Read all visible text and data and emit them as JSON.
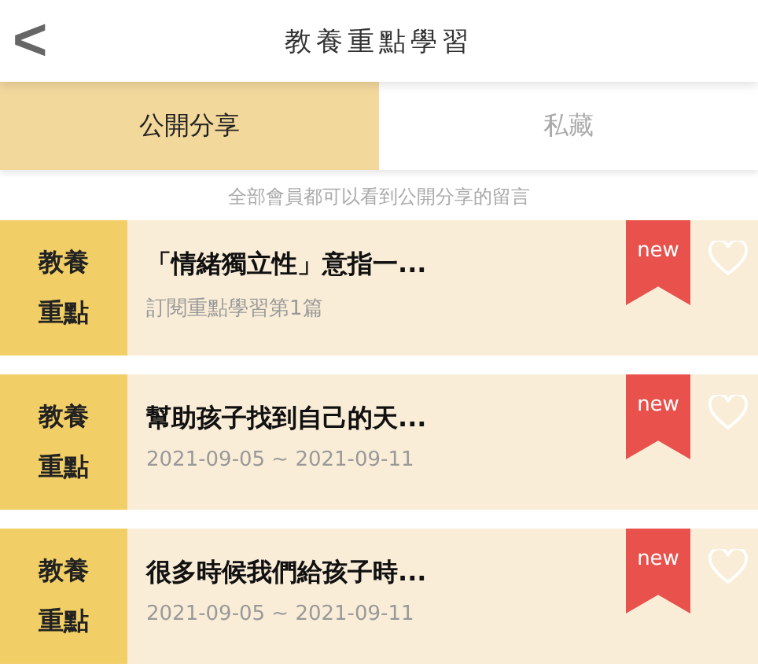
{
  "header": {
    "back": "<",
    "title": "教養重點學習"
  },
  "tabs": [
    {
      "label": "公開分享",
      "selected": true
    },
    {
      "label": "私藏",
      "selected": false
    }
  ],
  "notice": "全部會員都可以看到公開分享的留言",
  "cards": [
    {
      "tag": "教養重點",
      "title": "「情緒獨立性」意指一...",
      "subtitle": "訂閱重點學習第1篇",
      "badge": "new",
      "liked": false
    },
    {
      "tag": "教養重點",
      "title": "幫助孩子找到自己的天...",
      "subtitle": "2021-09-05 ~ 2021-09-11",
      "badge": "new",
      "liked": false
    },
    {
      "tag": "教養重點",
      "title": "很多時候我們給孩子時...",
      "subtitle": "2021-09-05 ~ 2021-09-11",
      "badge": "new",
      "liked": false
    }
  ]
}
